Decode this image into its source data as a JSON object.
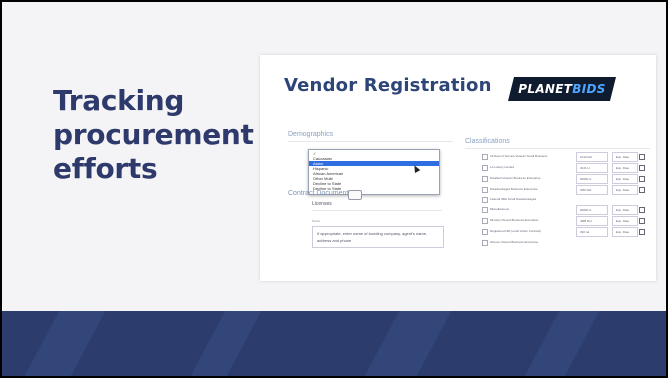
{
  "slide": {
    "title": "Tracking procurement efforts"
  },
  "screenshot": {
    "heading": "Vendor Registration",
    "logo": {
      "text_main": "PLANET",
      "text_accent": "BIDS"
    },
    "demographics_label": "Demographics",
    "classifications_label": "Classifications",
    "dropdown_options": [
      "✓",
      "Caucasian",
      "Asian",
      "Hispanic",
      "African American",
      "Other Multi",
      "Decline to State",
      "Decline to State"
    ],
    "dropdown_selected_index": 2,
    "contract_label": "Contract Documents",
    "licenses_label": "Licenses",
    "name_label": "Name",
    "textarea_line1": "If appropriate, enter name of bonding company, agent's name,",
    "textarea_line2": "address and phone",
    "classifications": [
      {
        "label": "All Dept of Service Veteran Small Business",
        "number": "1010 Ref",
        "date": "Exp. Date"
      },
      {
        "label": "LA Lottery Limited",
        "number": "3121 H",
        "date": "Exp. Date"
      },
      {
        "label": "Disabled Veteran Business Enterprise",
        "number": "00000 w",
        "date": "Exp. Date"
      },
      {
        "label": "Disadvantaged Business Enterprise",
        "number": "3M6 Ref",
        "date": "Exp. Date"
      },
      {
        "label": "Federal SBA Small Disadvantaged",
        "number": "",
        "date": ""
      },
      {
        "label": "Miscellaneous",
        "number": "00000 w",
        "date": "Exp. Date"
      },
      {
        "label": "Minority Owned Business Enterprise",
        "number": "4MB Ref",
        "date": "Exp. Date"
      },
      {
        "label": "Registered LBI (Local Visitor Contract)",
        "number": "330 rel",
        "date": "Exp. Date"
      },
      {
        "label": "Women Owned Business Enterprise",
        "number": "",
        "date": ""
      }
    ]
  }
}
